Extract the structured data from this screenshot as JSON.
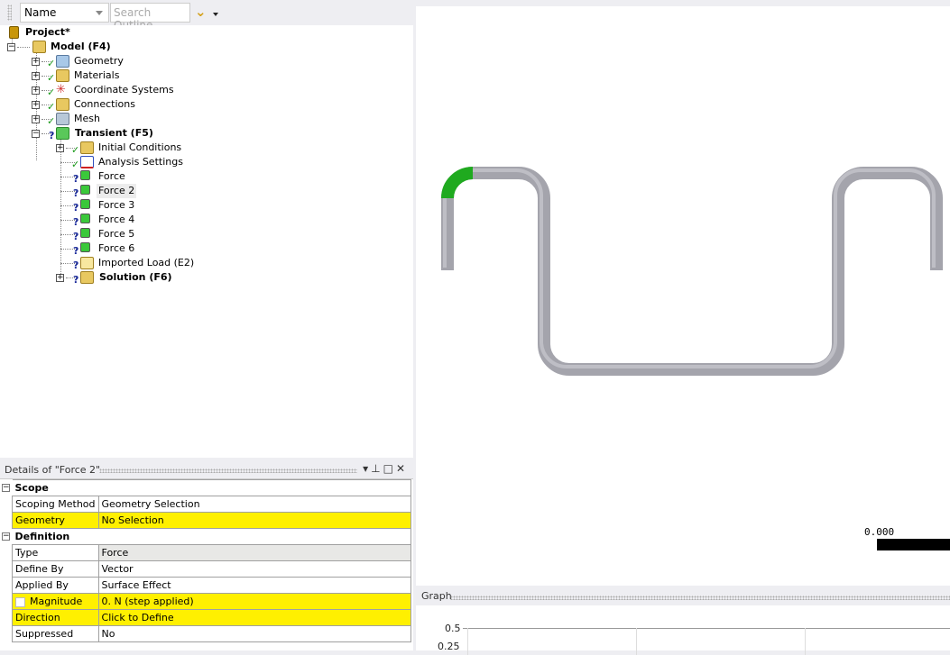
{
  "toolbar": {
    "filter_select": "Name",
    "search_placeholder": "Search Outline"
  },
  "tree": {
    "project": "Project*",
    "model": "Model (F4)",
    "model_children": [
      "Geometry",
      "Materials",
      "Coordinate Systems",
      "Connections",
      "Mesh"
    ],
    "transient": "Transient (F5)",
    "transient_children": [
      "Initial Conditions",
      "Analysis Settings",
      "Force",
      "Force 2",
      "Force 3",
      "Force 4",
      "Force 5",
      "Force 6",
      "Imported Load (E2)"
    ],
    "solution": "Solution (F6)",
    "selected": "Force 2"
  },
  "details": {
    "title": "Details of \"Force 2\"",
    "header_buttons": [
      "▾",
      "⊥",
      "□",
      "✕"
    ],
    "sections": [
      {
        "name": "Scope",
        "rows": [
          [
            "Scoping Method",
            "Geometry Selection"
          ],
          [
            "Geometry",
            "No Selection"
          ]
        ]
      },
      {
        "name": "Definition",
        "rows": [
          [
            "Type",
            "Force"
          ],
          [
            "Define By",
            "Vector"
          ],
          [
            "Applied By",
            "Surface Effect"
          ],
          [
            "Magnitude",
            "0. N  (step applied)"
          ],
          [
            "Direction",
            "Click to Define"
          ],
          [
            "Suppressed",
            "No"
          ]
        ]
      }
    ]
  },
  "viewport": {
    "scale_label": "0.000",
    "highlight_color": "#1faa1f",
    "pipe_color": "#a0a0a8"
  },
  "graph": {
    "title": "Graph",
    "y_ticks": [
      "0.5",
      "0.25"
    ]
  }
}
